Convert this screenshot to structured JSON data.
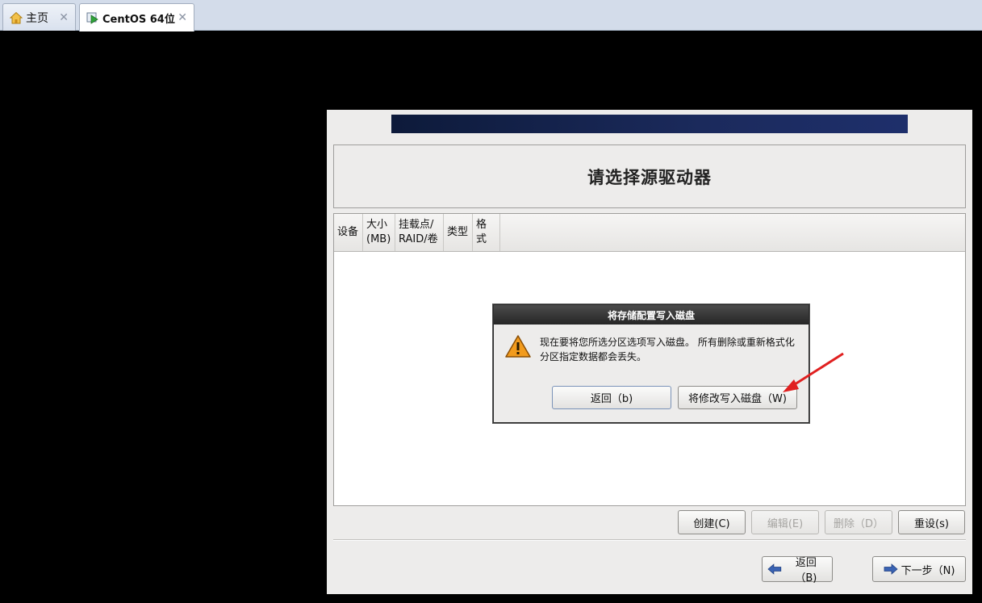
{
  "tabs": [
    {
      "label": "主页",
      "icon": "home-icon"
    },
    {
      "label": "CentOS 64位",
      "icon": "vm-play-icon"
    }
  ],
  "installer": {
    "title": "请选择源驱动器",
    "table": {
      "columns": [
        "设备",
        "大小\n(MB)",
        "挂载点/\nRAID/卷",
        "类型",
        "格式"
      ]
    },
    "actions": {
      "create": "创建(C)",
      "edit": "编辑(E)",
      "delete": "删除（D）",
      "reset": "重设(s)"
    },
    "nav": {
      "back": "返回（B)",
      "next": "下一步（N)"
    }
  },
  "dialog": {
    "title": "将存储配置写入磁盘",
    "message": "现在要将您所选分区选项写入磁盘。 所有删除或重新格式化分区指定数据都会丢失。",
    "cancel": "返回（b)",
    "confirm": "将修改写入磁盘（W)",
    "icon": "warning-icon"
  },
  "colors": {
    "banner": "#14224b",
    "annotation_arrow": "#e02020"
  }
}
